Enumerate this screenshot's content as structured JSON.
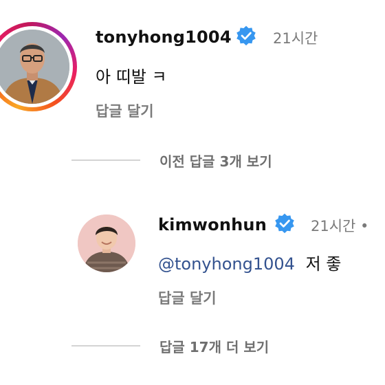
{
  "comment": {
    "username": "tonyhong1004",
    "time": "21시간",
    "text": "아  띠발  ㅋ",
    "reply_label": "답글 달기"
  },
  "view_previous": "이전 답글 3개 보기",
  "reply": {
    "username": "kimwonhun",
    "time": "21시간 •",
    "mention": "@tonyhong1004",
    "text": "저 좋",
    "reply_label": "답글 달기"
  },
  "view_more": "답글 17개 더 보기",
  "colors": {
    "verified": "#3797f0",
    "mention": "#33528f",
    "muted": "#7a7a7a"
  }
}
